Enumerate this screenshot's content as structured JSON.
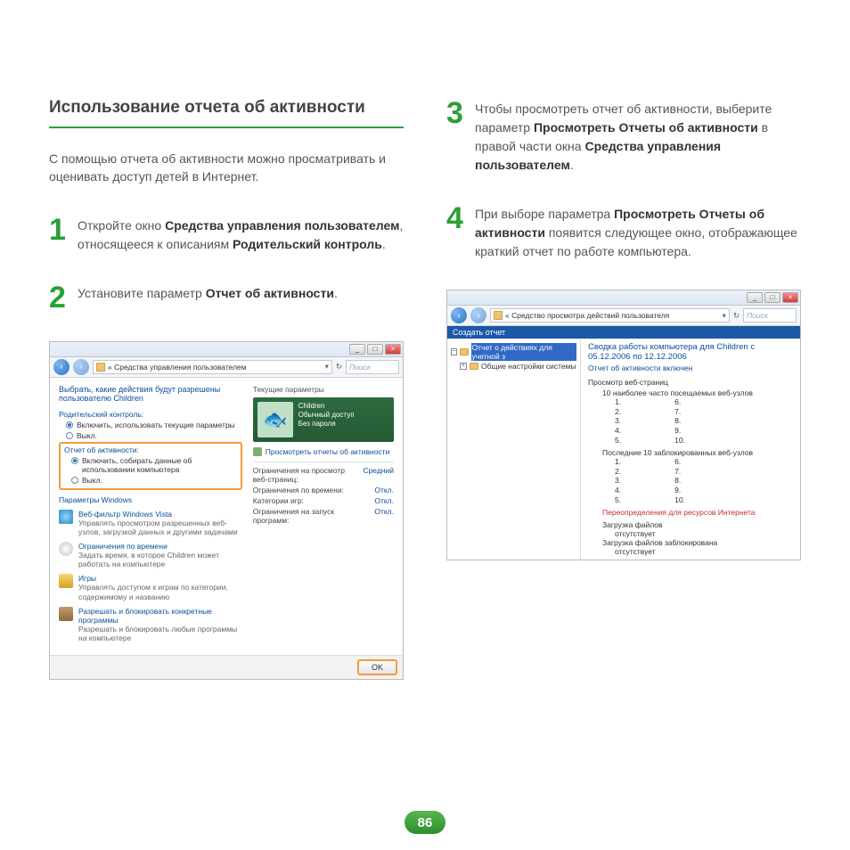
{
  "title": "Использование отчета об активности",
  "intro": "С помощью отчета об активности можно просматривать и оценивать доступ детей в Интернет.",
  "page_number": "86",
  "steps": {
    "s1": {
      "num": "1",
      "pre": "Откройте окно ",
      "b1": "Средства управления пользователем",
      "mid": ", относящееся к описаниям ",
      "b2": "Родительский контроль",
      "post": "."
    },
    "s2": {
      "num": "2",
      "pre": "Установите параметр ",
      "b1": "Отчет об активности",
      "post": "."
    },
    "s3": {
      "num": "3",
      "pre": "Чтобы просмотреть отчет об активности, выберите параметр ",
      "b1": "Просмотреть Отчеты об активности",
      "mid": " в правой части окна ",
      "b2": "Средства управления пользователем",
      "post": "."
    },
    "s4": {
      "num": "4",
      "pre": "При выборе параметра ",
      "b1": "Просмотреть Отчеты об активности",
      "post": " появится следующее окно, отображающее краткий отчет по работе компьютера."
    }
  },
  "shot1": {
    "breadcrumb": "« Средства управления пользователем",
    "search": "Поиск",
    "heading": "Выбрать, какие действия будут разрешены пользователю Children",
    "parental_label": "Родительский контроль:",
    "parental_on": "Включить, использовать текущие параметры",
    "off": "Выкл.",
    "activity_label": "Отчет об активности:",
    "activity_on": "Включить, собирать данные об использовании компьютера",
    "params_label": "Параметры Windows",
    "webfilter_t": "Веб-фильтр Windows Vista",
    "webfilter_d": "Управлять просмотром разрешенных веб-узлов, загрузкой данных и другими задачами",
    "time_t": "Ограничения по времени",
    "time_d": "Задать время, в которое Children может работать на компьютере",
    "games_t": "Игры",
    "games_d": "Управлять доступом к играм по категории, содержимому и названию",
    "progs_t": "Разрешать и блокировать конкретные программы",
    "progs_d": "Разрешать и блокировать любые программы на компьютере",
    "user_name": "Children",
    "user_access": "Обычный доступ",
    "user_pw": "Без пароля",
    "view_reports": "Просмотреть отчеты об активности",
    "current_params": "Текущие параметры",
    "rows": {
      "web_l": "Ограничения на просмотр веб-страниц:",
      "web_v": "Средний",
      "time_l": "Ограничения по времени:",
      "time_v": "Откл.",
      "cat_l": "Категории игр:",
      "cat_v": "Откл.",
      "launch_l": "Ограничения на запуск программ:",
      "launch_v": "Откл."
    },
    "ok": "OK"
  },
  "shot2": {
    "breadcrumb": "« Средство просмотра действий пользователя",
    "search": "Поиск",
    "create": "Создать отчет",
    "tree_sel": "Отчет о действиях для учетной з",
    "tree_other": "Общие настройки системы",
    "h1": "Сводка работы компьютера для Children с 05.12.2006 по 12.12.2006",
    "h2": "Отчет об активности включен",
    "sec_web": "Просмотр веб-страниц",
    "top10": "10 наиболее часто посещаемых веб-узлов",
    "blocked10": "Последние 10 заблокированных веб-узлов",
    "redir": "Переопределения для ресурсов Интернета",
    "dl_files": "Загрузка файлов",
    "dl_blocked": "Загрузка файлов заблокирована",
    "none": "отсутствует",
    "left_nums": [
      "1.",
      "2.",
      "3.",
      "4.",
      "5."
    ],
    "right_nums": [
      "6.",
      "7.",
      "8.",
      "9.",
      "10."
    ]
  }
}
